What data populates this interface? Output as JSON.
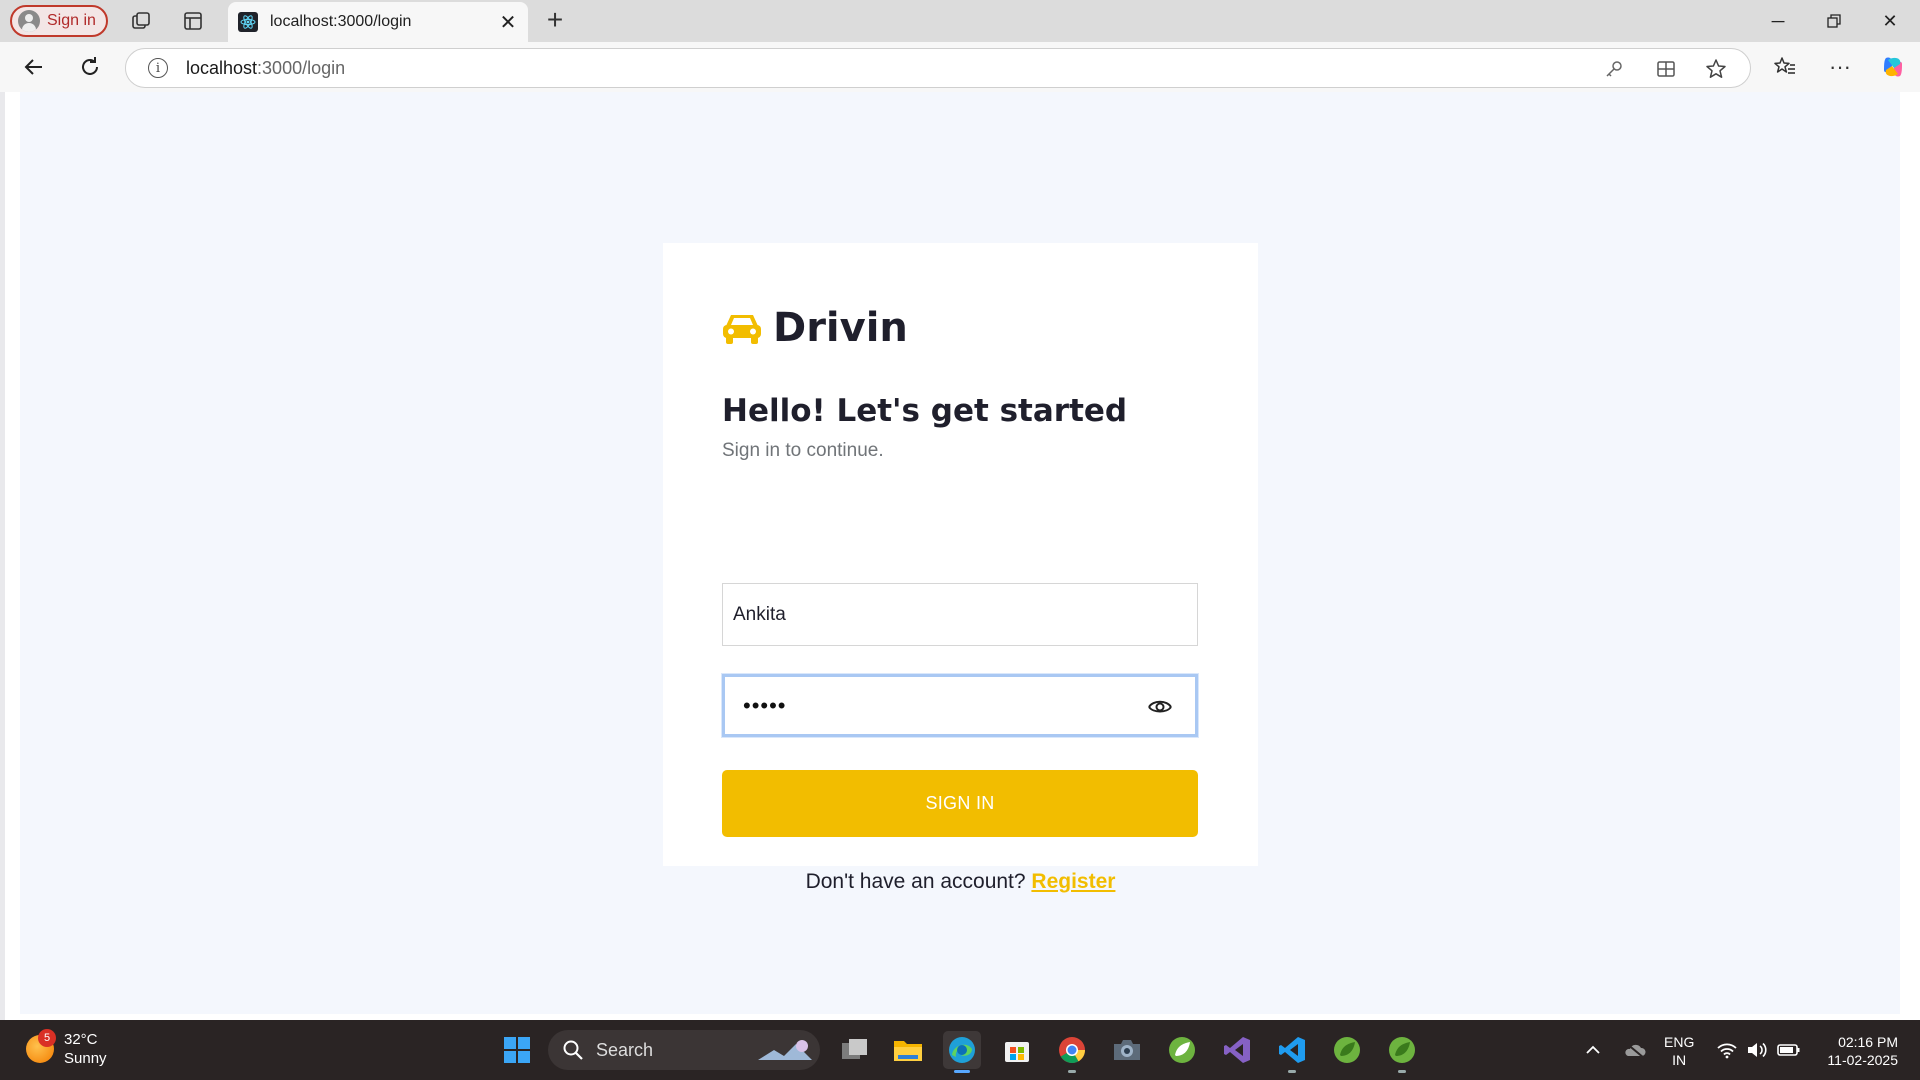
{
  "browser": {
    "profile_label": "Sign in",
    "tab_title": "localhost:3000/login",
    "url_host": "localhost",
    "url_path": ":3000/login"
  },
  "page": {
    "brand_name": "Drivin",
    "heading": "Hello! Let's get started",
    "subheading": "Sign in to continue.",
    "username_value": "Ankita",
    "password_mask": "•••••",
    "signin_label": "SIGN IN",
    "register_prompt": "Don't have an account? ",
    "register_link": "Register",
    "accent_color": "#f2bd00"
  },
  "taskbar": {
    "weather_temp": "32°C",
    "weather_desc": "Sunny",
    "weather_badge": "5",
    "search_label": "Search",
    "lang_line1": "ENG",
    "lang_line2": "IN",
    "time": "02:16 PM",
    "date": "11-02-2025"
  }
}
